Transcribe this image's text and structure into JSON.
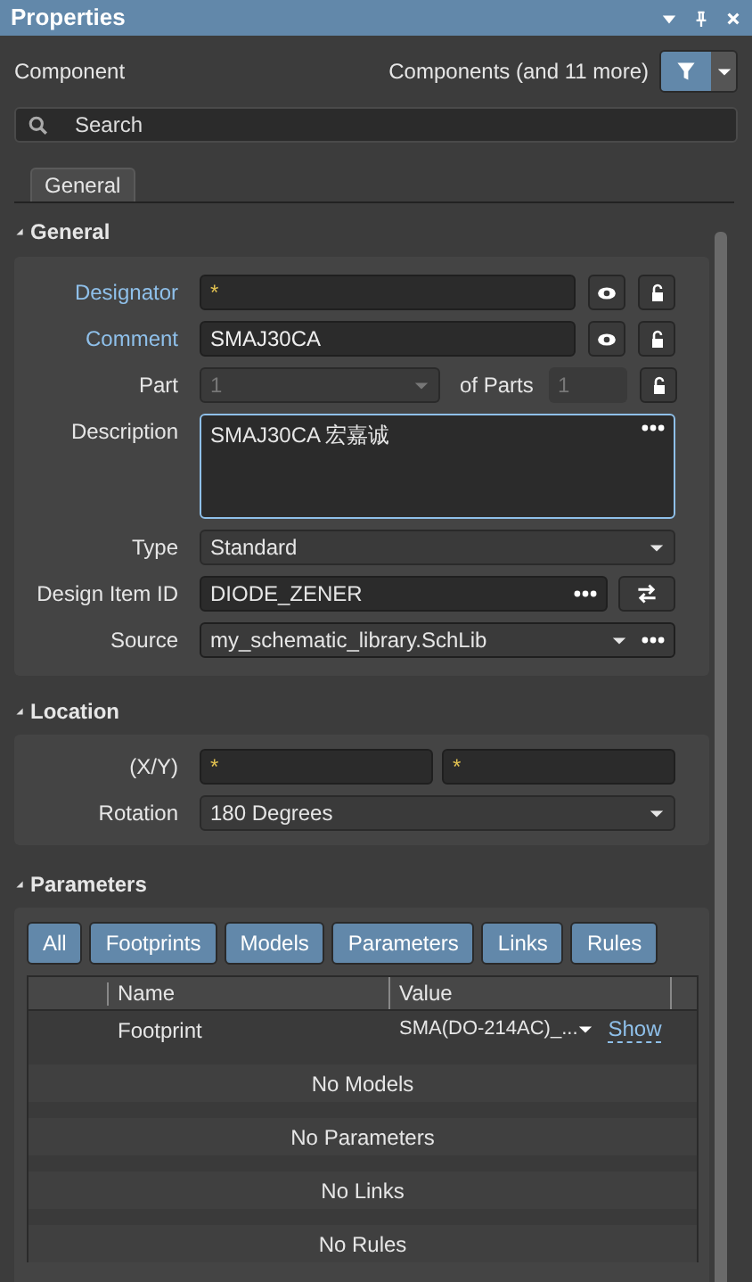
{
  "window": {
    "title": "Properties"
  },
  "header": {
    "label": "Component",
    "filter_summary": "Components (and 11 more)"
  },
  "search": {
    "placeholder": "Search"
  },
  "tabs": [
    {
      "label": "General",
      "selected": true
    }
  ],
  "general": {
    "title": "General",
    "expanded": true,
    "fields": [
      {
        "kind": "text",
        "label": "Designator",
        "highlighted": true,
        "value": "*",
        "varies": true,
        "visible_toggle": true,
        "locked": false
      },
      {
        "kind": "text",
        "label": "Comment",
        "highlighted": true,
        "value": "SMAJ30CA",
        "varies": false,
        "visible_toggle": true,
        "locked": false
      },
      {
        "kind": "part",
        "label": "Part",
        "value": "1",
        "of_label": "of Parts",
        "of_value": "1",
        "locked": false
      },
      {
        "kind": "multiline",
        "label": "Description",
        "highlighted": false,
        "value": "SMAJ30CA 宏嘉诚"
      },
      {
        "kind": "dropdown",
        "label": "Type",
        "highlighted": false,
        "value": "Standard"
      },
      {
        "kind": "item_id",
        "label": "Design Item ID",
        "highlighted": false,
        "value": "DIODE_ZENER"
      },
      {
        "kind": "source",
        "label": "Source",
        "highlighted": false,
        "value": "my_schematic_library.SchLib"
      }
    ]
  },
  "location": {
    "title": "Location",
    "expanded": true,
    "xy_label": "(X/Y)",
    "x": "*",
    "y": "*",
    "rotation_label": "Rotation",
    "rotation": "180 Degrees"
  },
  "parameters": {
    "title": "Parameters",
    "expanded": true,
    "filters": [
      "All",
      "Footprints",
      "Models",
      "Parameters",
      "Links",
      "Rules"
    ],
    "columns": [
      "Name",
      "Value"
    ],
    "rows": [
      {
        "name": "Footprint",
        "value": "SMA(DO-214AC)_...",
        "action": "Show"
      }
    ],
    "empty_messages": [
      "No Models",
      "No Parameters",
      "No Links",
      "No Rules"
    ]
  }
}
